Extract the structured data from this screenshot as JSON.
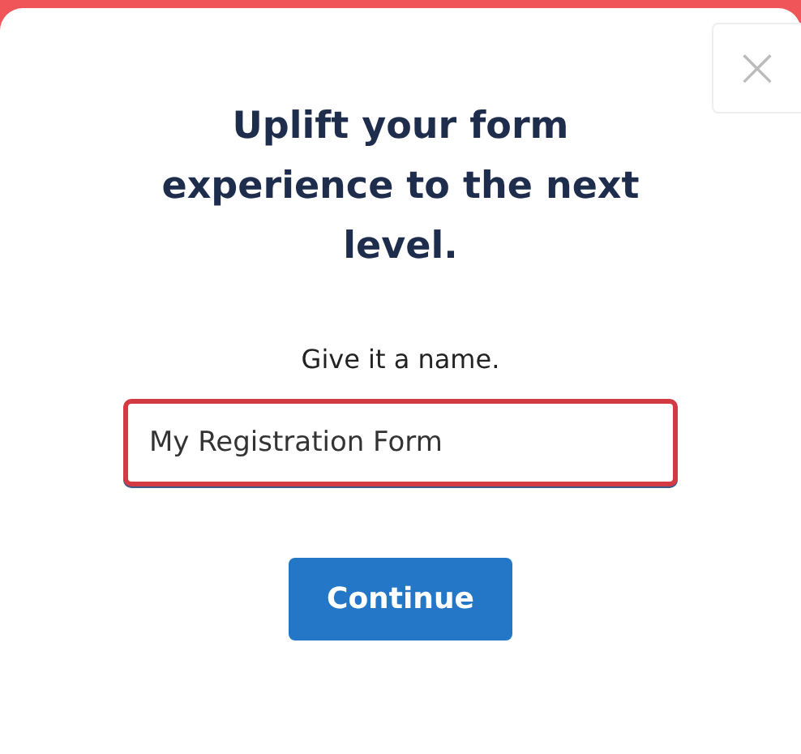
{
  "dialog": {
    "close_label": "×",
    "title": "Uplift your form experience to the next level.",
    "prompt": "Give it a name.",
    "name_field": {
      "value": "My Registration Form",
      "focused": true
    },
    "buttons": [
      {
        "label": "Continue",
        "kind": "primary"
      }
    ]
  }
}
